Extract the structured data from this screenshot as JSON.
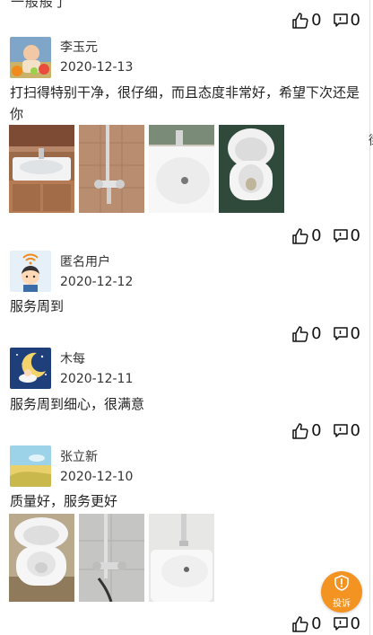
{
  "top_partial_text": "一般般了",
  "edge_glyph": "街",
  "reviews": [
    {
      "name": "",
      "date": "",
      "content": "",
      "likes": "0",
      "comments": "0"
    },
    {
      "name": "李玉元",
      "date": "2020-12-13",
      "content": "打扫得特别干净，很仔细，而且态度非常好，希望下次还是你",
      "likes": "0",
      "comments": "0",
      "photos": [
        "washbasin-photo",
        "shower-faucet-photo",
        "sink-photo",
        "toilet-photo"
      ]
    },
    {
      "name": "匿名用户",
      "date": "2020-12-12",
      "content": "服务周到",
      "likes": "0",
      "comments": "0"
    },
    {
      "name": "木每",
      "date": "2020-12-11",
      "content": "服务周到细心，很满意",
      "likes": "0",
      "comments": "0"
    },
    {
      "name": "张立新",
      "date": "2020-12-10",
      "content": "质量好，服务更好",
      "likes": "0",
      "comments": "0",
      "photos": [
        "toilet-photo",
        "shower-pipe-photo",
        "sink-photo"
      ]
    }
  ],
  "complaint_button": {
    "label": "投诉",
    "color": "#f39322"
  },
  "icons": {
    "like": "thumbs-up-icon",
    "comment": "comment-icon"
  }
}
